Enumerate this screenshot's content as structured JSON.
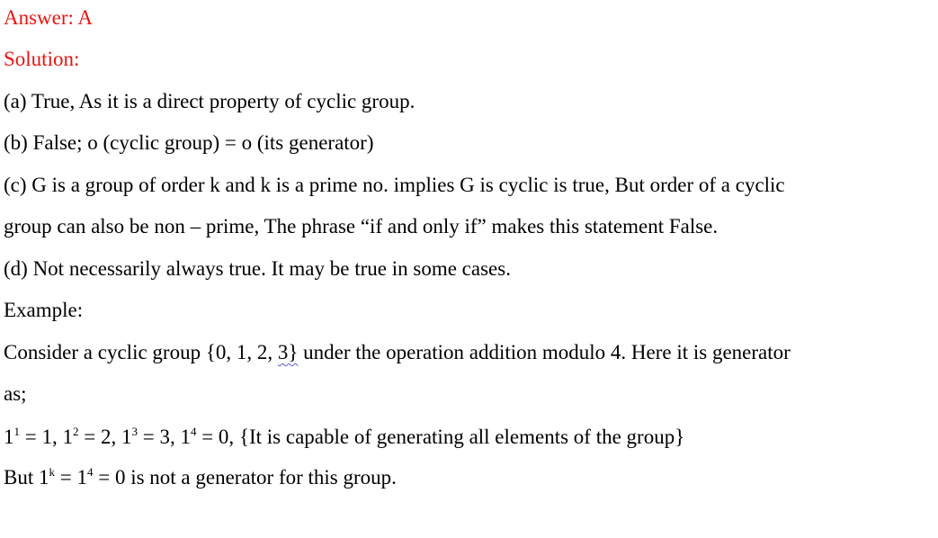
{
  "answer_label": "Answer: A",
  "solution_label": "Solution:",
  "lines": {
    "a": "(a) True, As it is a direct property of cyclic group.",
    "b": "(b) False; o (cyclic group) = o (its generator)",
    "c1": "(c) G is a group of order k and k is a prime no. implies G is cyclic is true, But order of a cyclic",
    "c2": "group can also be non – prime, The phrase “if and only if” makes this statement False.",
    "d": "(d) Not necessarily always true. It may be true in some cases.",
    "example": "Example:",
    "consider_pre": "Consider a cyclic group {0, 1, 2, ",
    "consider_squiggle": "3}",
    "consider_post": " under the operation addition modulo 4. Here it is generator",
    "as": "as;"
  },
  "powers": {
    "t1_base": "1",
    "t1_exp": "1",
    "t1_rest": " = 1, ",
    "t2_base": "1",
    "t2_exp": "2",
    "t2_rest": " = 2, ",
    "t3_base": "1",
    "t3_exp": "3",
    "t3_rest": " = 3, ",
    "t4_base": "1",
    "t4_exp": "4",
    "t4_rest": " = 0,  ",
    "note": "{It is capable of generating all elements of the group}"
  },
  "final": {
    "prefix": "But 1",
    "exp_k": "k",
    "mid": " = 1",
    "exp_4": "4",
    "suffix": " = 0 is not a generator for this group."
  },
  "colors": {
    "heading_red": "#e8140f",
    "text": "#000000"
  }
}
